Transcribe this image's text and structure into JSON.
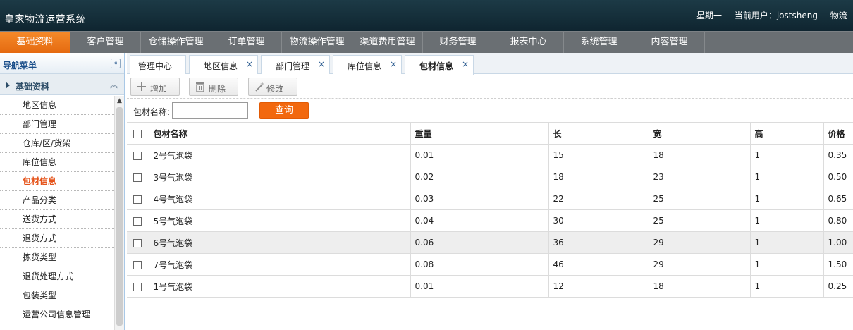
{
  "header": {
    "title": "皇家物流运营系统",
    "weekday": "星期一",
    "user_label": "当前用户：jostsheng",
    "trailing": "物流"
  },
  "main_nav": [
    {
      "label": "基础资料",
      "active": true
    },
    {
      "label": "客户管理"
    },
    {
      "label": "仓储操作管理"
    },
    {
      "label": "订单管理"
    },
    {
      "label": "物流操作管理"
    },
    {
      "label": "渠道费用管理"
    },
    {
      "label": "财务管理"
    },
    {
      "label": "报表中心"
    },
    {
      "label": "系统管理"
    },
    {
      "label": "内容管理"
    }
  ],
  "sidebar": {
    "title": "导航菜单",
    "collapse_icon": "«",
    "group_label": "基础资料",
    "items": [
      {
        "label": "地区信息"
      },
      {
        "label": "部门管理"
      },
      {
        "label": "仓库/区/货架"
      },
      {
        "label": "库位信息"
      },
      {
        "label": "包材信息",
        "active": true
      },
      {
        "label": "产品分类"
      },
      {
        "label": "送货方式"
      },
      {
        "label": "退货方式"
      },
      {
        "label": "拣货类型"
      },
      {
        "label": "退货处理方式"
      },
      {
        "label": "包装类型"
      },
      {
        "label": "运营公司信息管理"
      }
    ]
  },
  "tabs": [
    {
      "label": "管理中心",
      "closable": false
    },
    {
      "label": "地区信息",
      "closable": true
    },
    {
      "label": "部门管理",
      "closable": true
    },
    {
      "label": "库位信息",
      "closable": true
    },
    {
      "label": "包材信息",
      "closable": true,
      "active": true
    }
  ],
  "tab_close_glyph": "×",
  "toolbar": {
    "add_label": "增加",
    "delete_label": "删除",
    "edit_label": "修改"
  },
  "search": {
    "label": "包材名称:",
    "value": "",
    "button_label": "查询"
  },
  "table": {
    "columns": [
      "包材名称",
      "重量",
      "长",
      "宽",
      "高",
      "价格"
    ],
    "rows": [
      [
        "2号气泡袋",
        "0.01",
        "15",
        "18",
        "1",
        "0.35"
      ],
      [
        "3号气泡袋",
        "0.02",
        "18",
        "23",
        "1",
        "0.50"
      ],
      [
        "4号气泡袋",
        "0.03",
        "22",
        "25",
        "1",
        "0.65"
      ],
      [
        "5号气泡袋",
        "0.04",
        "30",
        "25",
        "1",
        "0.80"
      ],
      [
        "6号气泡袋",
        "0.06",
        "36",
        "29",
        "1",
        "1.00"
      ],
      [
        "7号气泡袋",
        "0.08",
        "46",
        "29",
        "1",
        "1.50"
      ],
      [
        "1号气泡袋",
        "0.01",
        "12",
        "18",
        "1",
        "0.25"
      ]
    ],
    "highlighted_row": 4
  },
  "colors": {
    "accent": "#f2680e",
    "header_bg": "#153040",
    "nav_bg": "#6a6f73",
    "active_menu": "#e5531a"
  }
}
